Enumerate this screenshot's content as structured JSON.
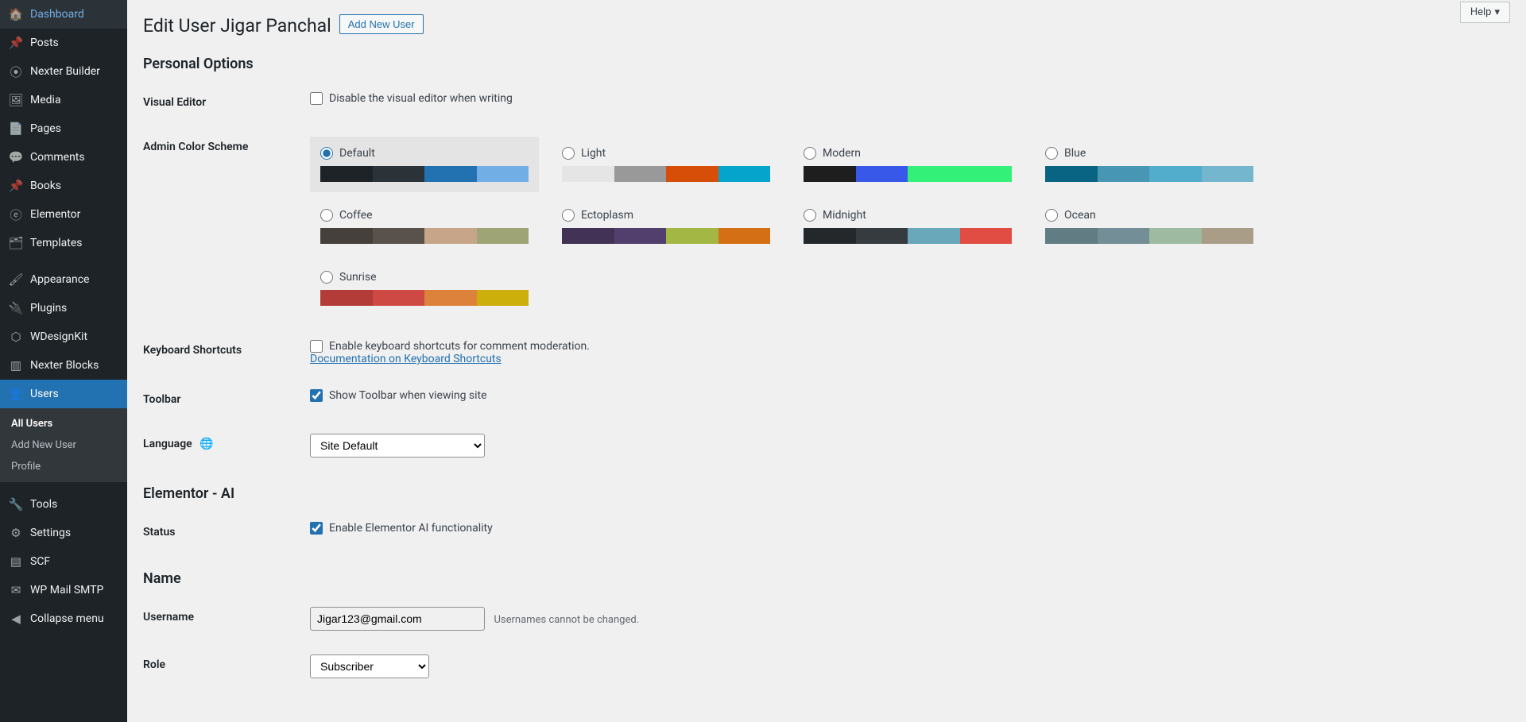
{
  "header": {
    "page_title": "Edit User Jigar Panchal",
    "add_new": "Add New User",
    "help_label": "Help"
  },
  "sidebar": {
    "items": [
      {
        "name": "dashboard",
        "label": "Dashboard",
        "icon": "🏠"
      },
      {
        "name": "posts",
        "label": "Posts",
        "icon": "📌"
      },
      {
        "name": "nexter-builder",
        "label": "Nexter Builder",
        "icon": "⦿"
      },
      {
        "name": "media",
        "label": "Media",
        "icon": "🖼"
      },
      {
        "name": "pages",
        "label": "Pages",
        "icon": "📄"
      },
      {
        "name": "comments",
        "label": "Comments",
        "icon": "💬"
      },
      {
        "name": "books",
        "label": "Books",
        "icon": "📌"
      },
      {
        "name": "elementor",
        "label": "Elementor",
        "icon": "ⓔ"
      },
      {
        "name": "templates",
        "label": "Templates",
        "icon": "🗂"
      },
      {
        "name": "appearance",
        "label": "Appearance",
        "icon": "🖌"
      },
      {
        "name": "plugins",
        "label": "Plugins",
        "icon": "🔌"
      },
      {
        "name": "wdesignkit",
        "label": "WDesignKit",
        "icon": "⬡"
      },
      {
        "name": "nexter-blocks",
        "label": "Nexter Blocks",
        "icon": "▥"
      },
      {
        "name": "users",
        "label": "Users",
        "icon": "👤",
        "active": true
      },
      {
        "name": "tools",
        "label": "Tools",
        "icon": "🔧"
      },
      {
        "name": "settings",
        "label": "Settings",
        "icon": "⚙"
      },
      {
        "name": "scf",
        "label": "SCF",
        "icon": "▤"
      },
      {
        "name": "wp-mail-smtp",
        "label": "WP Mail SMTP",
        "icon": "✉"
      },
      {
        "name": "collapse-menu",
        "label": "Collapse menu",
        "icon": "◀"
      }
    ],
    "submenu": [
      {
        "label": "All Users",
        "active": true
      },
      {
        "label": "Add New User"
      },
      {
        "label": "Profile"
      }
    ]
  },
  "sections": {
    "personal_options": "Personal Options",
    "elementor_ai": "Elementor - AI",
    "name": "Name"
  },
  "form": {
    "visual_editor": {
      "label": "Visual Editor",
      "checkbox": "Disable the visual editor when writing",
      "checked": false
    },
    "admin_color": {
      "label": "Admin Color Scheme",
      "selected": "default",
      "schemes": [
        {
          "id": "default",
          "name": "Default",
          "colors": [
            "#1d2327",
            "#2c3338",
            "#2271b1",
            "#72aee6"
          ]
        },
        {
          "id": "light",
          "name": "Light",
          "colors": [
            "#e5e5e5",
            "#999999",
            "#d64e07",
            "#04a4cc"
          ]
        },
        {
          "id": "modern",
          "name": "Modern",
          "colors": [
            "#1e1e1e",
            "#3858e9",
            "#33f078",
            "#33f078"
          ]
        },
        {
          "id": "blue",
          "name": "Blue",
          "colors": [
            "#096484",
            "#4796b3",
            "#52accc",
            "#74b6ce"
          ]
        },
        {
          "id": "coffee",
          "name": "Coffee",
          "colors": [
            "#46403c",
            "#59524c",
            "#c7a589",
            "#9ea476"
          ]
        },
        {
          "id": "ectoplasm",
          "name": "Ectoplasm",
          "colors": [
            "#413256",
            "#523f6d",
            "#a3b745",
            "#d46f15"
          ]
        },
        {
          "id": "midnight",
          "name": "Midnight",
          "colors": [
            "#25282b",
            "#363b3f",
            "#69a8bb",
            "#e14d43"
          ]
        },
        {
          "id": "ocean",
          "name": "Ocean",
          "colors": [
            "#627c83",
            "#738e96",
            "#9ebaa0",
            "#aa9d88"
          ]
        },
        {
          "id": "sunrise",
          "name": "Sunrise",
          "colors": [
            "#b43c38",
            "#cf4944",
            "#dd823b",
            "#ccaf0b"
          ]
        }
      ]
    },
    "keyboard_shortcuts": {
      "label": "Keyboard Shortcuts",
      "checkbox": "Enable keyboard shortcuts for comment moderation.",
      "doc_link": "Documentation on Keyboard Shortcuts",
      "checked": false
    },
    "toolbar": {
      "label": "Toolbar",
      "checkbox": "Show Toolbar when viewing site",
      "checked": true
    },
    "language": {
      "label": "Language",
      "icon_alt": "🌐",
      "value": "Site Default"
    },
    "elementor_ai_status": {
      "label": "Status",
      "checkbox": "Enable Elementor AI functionality",
      "checked": true
    },
    "username": {
      "label": "Username",
      "value": "Jigar123@gmail.com",
      "description": "Usernames cannot be changed."
    },
    "role": {
      "label": "Role",
      "value": "Subscriber"
    }
  }
}
